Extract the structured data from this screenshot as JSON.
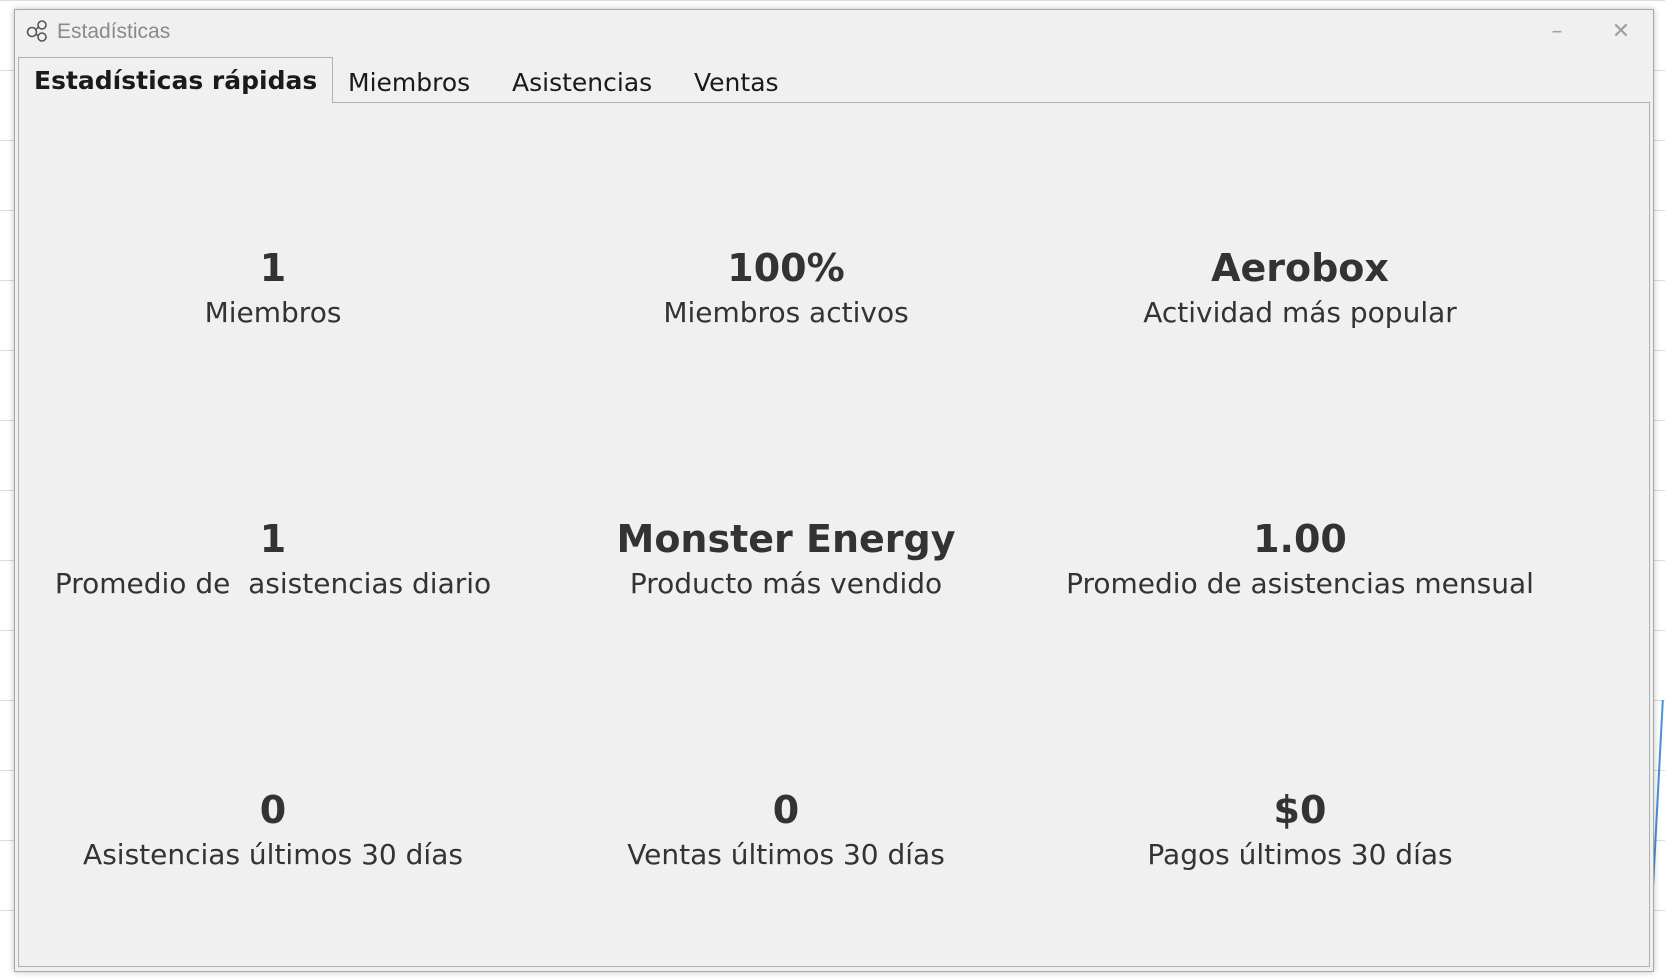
{
  "window": {
    "title": "Estadísticas",
    "icon": "chart-nodes-icon",
    "minimize_label": "–",
    "close_label": "✕"
  },
  "tabs": [
    {
      "label": "Estadísticas rápidas",
      "active": true
    },
    {
      "label": "Miembros",
      "active": false
    },
    {
      "label": "Asistencias",
      "active": false
    },
    {
      "label": "Ventas",
      "active": false
    }
  ],
  "stats": [
    {
      "value": "1",
      "label": "Miembros"
    },
    {
      "value": "100%",
      "label": "Miembros activos"
    },
    {
      "value": "Aerobox",
      "label": "Actividad más popular"
    },
    {
      "value": "1",
      "label": "Promedio de  asistencias diario"
    },
    {
      "value": "Monster Energy",
      "label": "Producto más vendido"
    },
    {
      "value": "1.00",
      "label": "Promedio de asistencias mensual"
    },
    {
      "value": "0",
      "label": "Asistencias últimos 30 días"
    },
    {
      "value": "0",
      "label": "Ventas últimos 30 días"
    },
    {
      "value": "$0",
      "label": "Pagos últimos 30 días"
    }
  ],
  "colors": {
    "window_bg": "#f0f0f0",
    "text": "#333333",
    "title_text": "#8a8a8a"
  }
}
